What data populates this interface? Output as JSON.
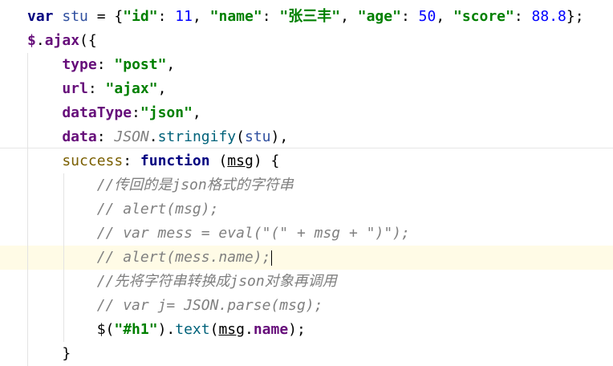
{
  "editor": {
    "lines": [
      {
        "tokens": [
          {
            "cls": "kw",
            "text": "var "
          },
          {
            "cls": "var",
            "text": "stu"
          },
          {
            "cls": "plain",
            "text": " = {"
          },
          {
            "cls": "str",
            "text": "\"id\""
          },
          {
            "cls": "plain",
            "text": ": "
          },
          {
            "cls": "num",
            "text": "11"
          },
          {
            "cls": "plain",
            "text": ", "
          },
          {
            "cls": "str",
            "text": "\"name\""
          },
          {
            "cls": "plain",
            "text": ": "
          },
          {
            "cls": "str",
            "text": "\"张三丰\""
          },
          {
            "cls": "plain",
            "text": ", "
          },
          {
            "cls": "str",
            "text": "\"age\""
          },
          {
            "cls": "plain",
            "text": ": "
          },
          {
            "cls": "num",
            "text": "50"
          },
          {
            "cls": "plain",
            "text": ", "
          },
          {
            "cls": "str",
            "text": "\"score\""
          },
          {
            "cls": "plain",
            "text": ": "
          },
          {
            "cls": "num",
            "text": "88.8"
          },
          {
            "cls": "plain",
            "text": "};"
          }
        ]
      },
      {
        "tokens": [
          {
            "cls": "prop",
            "text": "$"
          },
          {
            "cls": "plain",
            "text": "."
          },
          {
            "cls": "prop",
            "text": "ajax"
          },
          {
            "cls": "plain",
            "text": "({"
          }
        ]
      },
      {
        "tokens": [
          {
            "cls": "prop",
            "text": "    type"
          },
          {
            "cls": "plain",
            "text": ": "
          },
          {
            "cls": "str",
            "text": "\"post\""
          },
          {
            "cls": "plain",
            "text": ","
          }
        ]
      },
      {
        "tokens": [
          {
            "cls": "prop",
            "text": "    url"
          },
          {
            "cls": "plain",
            "text": ": "
          },
          {
            "cls": "str",
            "text": "\"ajax\""
          },
          {
            "cls": "plain",
            "text": ","
          }
        ]
      },
      {
        "tokens": [
          {
            "cls": "prop",
            "text": "    dataType"
          },
          {
            "cls": "plain",
            "text": ":"
          },
          {
            "cls": "str",
            "text": "\"json\""
          },
          {
            "cls": "plain",
            "text": ","
          }
        ]
      },
      {
        "tokens": [
          {
            "cls": "prop",
            "text": "    data"
          },
          {
            "cls": "plain",
            "text": ": "
          },
          {
            "cls": "comment",
            "text": "JSON"
          },
          {
            "cls": "plain",
            "text": "."
          },
          {
            "cls": "func",
            "text": "stringify"
          },
          {
            "cls": "plain",
            "text": "("
          },
          {
            "cls": "var",
            "text": "stu"
          },
          {
            "cls": "plain",
            "text": "),"
          }
        ]
      },
      {
        "tokens": [
          {
            "cls": "success",
            "text": "    success"
          },
          {
            "cls": "plain",
            "text": ": "
          },
          {
            "cls": "kw",
            "text": "function"
          },
          {
            "cls": "plain",
            "text": " ("
          },
          {
            "cls": "plain underline",
            "text": "msg"
          },
          {
            "cls": "plain",
            "text": ") {"
          }
        ]
      },
      {
        "tokens": [
          {
            "cls": "comment",
            "text": "        //传回的是json格式的字符串"
          }
        ]
      },
      {
        "tokens": [
          {
            "cls": "comment",
            "text": "        // alert(msg);"
          }
        ]
      },
      {
        "tokens": [
          {
            "cls": "comment",
            "text": "        // var mess = eval(\"(\" + msg + \")\");"
          }
        ]
      },
      {
        "tokens": [
          {
            "cls": "comment",
            "text": "        // alert(mess.name);"
          }
        ],
        "current": true
      },
      {
        "tokens": [
          {
            "cls": "comment",
            "text": "        //先将字符串转换成json对象再调用"
          }
        ]
      },
      {
        "tokens": [
          {
            "cls": "comment",
            "text": "        // var j= JSON.parse(msg);"
          }
        ]
      },
      {
        "tokens": [
          {
            "cls": "plain",
            "text": "        $("
          },
          {
            "cls": "str",
            "text": "\"#h1\""
          },
          {
            "cls": "plain",
            "text": ")."
          },
          {
            "cls": "func",
            "text": "text"
          },
          {
            "cls": "plain",
            "text": "("
          },
          {
            "cls": "plain underline",
            "text": "msg"
          },
          {
            "cls": "plain",
            "text": "."
          },
          {
            "cls": "prop",
            "text": "name"
          },
          {
            "cls": "plain",
            "text": ");"
          }
        ]
      },
      {
        "tokens": [
          {
            "cls": "plain",
            "text": "    }"
          }
        ]
      }
    ]
  }
}
